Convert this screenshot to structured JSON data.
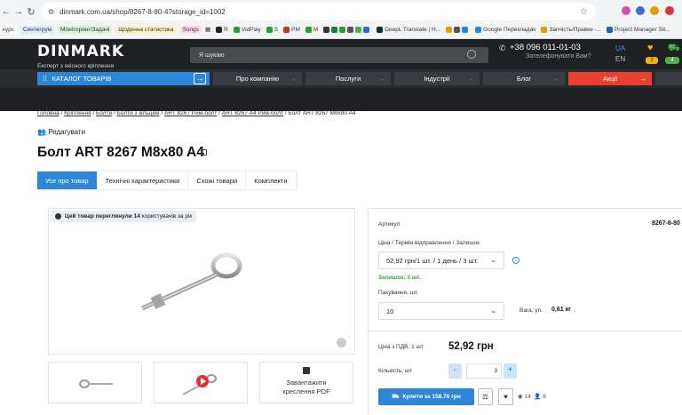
{
  "browser": {
    "url": "dinmark.com.ua/shop/8267-8-80-4?storage_id=1002",
    "bookmarks": [
      {
        "label": "курс",
        "color": "#ffffff"
      },
      {
        "label": "Синтегрум",
        "color": "#d9ecff"
      },
      {
        "label": "Моніторинг/Задачі",
        "color": "#d6f5d6"
      },
      {
        "label": "Щоденна статистика",
        "color": "#fff3c4"
      },
      {
        "label": "Songs",
        "color": "#ffd9e6"
      }
    ],
    "bookmark_short": [
      "R",
      "VidPlay",
      "S",
      "PM",
      "M"
    ],
    "bookmark_more": [
      "DeepL Translate | Н...",
      "Google Перекладач",
      "Запчість/Правки -...",
      "Project Manager Sit..."
    ]
  },
  "header": {
    "logo": "DINMARK",
    "tagline": "Експерт з якісного кріплення",
    "search_placeholder": "Я шукаю",
    "phone": "+38 096 011-01-03",
    "callback": "Зателефонувати Вам?",
    "lang_ua": "UA",
    "lang_en": "EN",
    "wishlist_count": "2",
    "cart_count": "4",
    "accent": "#2e87d6",
    "promo_color": "#e8402d"
  },
  "menu": {
    "catalog": "КАТАЛОГ ТОВАРІВ",
    "items": [
      "Про компанію",
      "Послуги",
      "Індустрії",
      "Блог",
      "Акції"
    ]
  },
  "breadcrumbs": [
    "Головна",
    "Кріплення",
    "Болти",
    "Болти з кільцем",
    "ART 8267 Рим-болт",
    "ART 8267 А4 Рим-болт",
    "Болт ART 8267 M8x80 A4"
  ],
  "edit_label": "Редагувати",
  "product": {
    "title": "Болт ART 8267 M8x80 A4",
    "tabs": [
      "Усе про товар",
      "Технічні характеристики",
      "Схожі товари",
      "Комплекти"
    ],
    "viewed_prefix": "Цей товар переглянули",
    "viewed_count": "14",
    "viewed_suffix": "користувачів за рік",
    "pdf_label_1": "Завантажити",
    "pdf_label_2": "креслення PDF"
  },
  "panel": {
    "article_label": "Артикул",
    "article_value": "8267-8-80",
    "price_term_label": "Ціна / Термін відправлення / Залишок",
    "price_option": "52,92 грн/1 шт. / 1 день / 3 шт.",
    "stock": "Залишок: 3 шт.",
    "pack_label": "Пакування, шт.",
    "pack_value": "10",
    "weight_label": "Вага, уп.",
    "weight_value": "0,61 кг",
    "price_vat_label": "Ціна з ПДВ, 1 шт",
    "price": "52,92 грн",
    "qty_label": "Кількість, шт",
    "qty_value": "3",
    "buy_label": "Купити за 158.76 грн",
    "views": "14",
    "users": "6"
  }
}
